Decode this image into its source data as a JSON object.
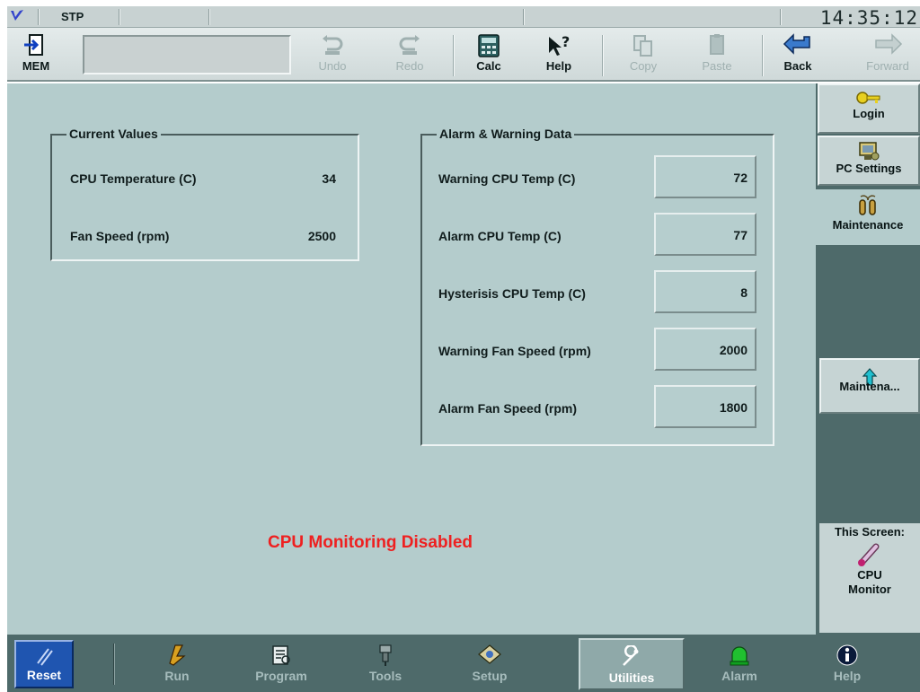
{
  "status": {
    "mode": "STP",
    "clock": "14:35:12"
  },
  "toolbar": {
    "mem_label": "MEM",
    "undo_label": "Undo",
    "redo_label": "Redo",
    "calc_label": "Calc",
    "help_label": "Help",
    "copy_label": "Copy",
    "paste_label": "Paste",
    "back_label": "Back",
    "forward_label": "Forward"
  },
  "current_values": {
    "title": "Current Values",
    "rows": [
      {
        "label": "CPU Temperature (C)",
        "value": "34"
      },
      {
        "label": "Fan Speed (rpm)",
        "value": "2500"
      }
    ]
  },
  "alarm_data": {
    "title": "Alarm & Warning Data",
    "rows": [
      {
        "label": "Warning CPU Temp (C)",
        "value": "72"
      },
      {
        "label": "Alarm CPU Temp (C)",
        "value": "77"
      },
      {
        "label": "Hysterisis CPU Temp (C)",
        "value": "8"
      },
      {
        "label": "Warning Fan Speed (rpm)",
        "value": "2000"
      },
      {
        "label": "Alarm Fan Speed (rpm)",
        "value": "1800"
      }
    ]
  },
  "status_message": "CPU Monitoring Disabled",
  "sidebar": {
    "tabs": [
      {
        "label": "Login",
        "icon": "key-icon"
      },
      {
        "label": "PC Settings",
        "icon": "pc-settings-icon"
      },
      {
        "label": "Maintenance",
        "icon": "maintenance-icon"
      }
    ],
    "maint_button_label": "Maintena...",
    "this_screen_label": "This Screen:",
    "this_screen_name_1": "CPU",
    "this_screen_name_2": "Monitor"
  },
  "bottom_nav": {
    "reset_label": "Reset",
    "items": [
      {
        "label": "Run"
      },
      {
        "label": "Program"
      },
      {
        "label": "Tools"
      },
      {
        "label": "Setup"
      },
      {
        "label": "Utilities"
      },
      {
        "label": "Alarm"
      },
      {
        "label": "Help"
      }
    ],
    "active": "Utilities"
  },
  "colors": {
    "panel": "#b4cccc",
    "dark_teal": "#4e6a6a",
    "status_red": "#ee2020",
    "reset_blue": "#1f55b0"
  }
}
